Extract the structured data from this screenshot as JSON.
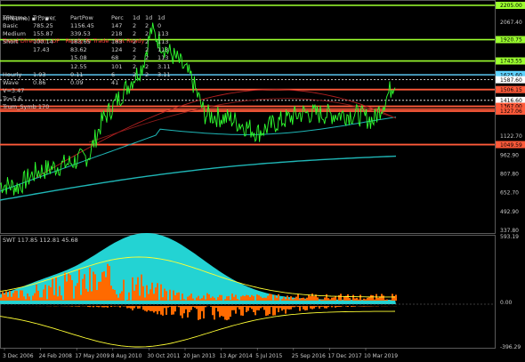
{
  "header": {
    "line1": "MM(1mo) ▪ ... ▪ ...",
    "trend_direction_label": "Trend Direction : UP",
    "ready_label": "Ready To Trade : Not Ready"
  },
  "table": {
    "headers": [
      "TFName",
      "TrPower",
      "PartPow",
      "Perc",
      "1d",
      "1d",
      "1d"
    ],
    "rows": [
      [
        "Basic",
        "785.25",
        "1156.45",
        "147",
        "2",
        "2",
        "0"
      ],
      [
        "Medium",
        "155.87",
        "339.53",
        "218",
        "2",
        "2",
        "113"
      ],
      [
        "Short",
        "100.14",
        "183.65",
        "183",
        "2",
        "2",
        "113"
      ],
      [
        "",
        "17.43",
        "83.62",
        "124",
        "2",
        "2",
        "113"
      ],
      [
        "",
        "",
        "15.08",
        "68",
        "2",
        "2",
        "113"
      ],
      [
        "",
        "",
        "12.55",
        "101",
        "2",
        "2",
        "3.11"
      ],
      [
        "Hourly",
        "1.93",
        "0.11",
        "6",
        "2",
        "2",
        "3.11"
      ],
      [
        "Wave",
        "0.86",
        "0.09",
        "41",
        "",
        "",
        ""
      ]
    ],
    "extra_lines": [
      "V=3.47",
      "Tr=5.6",
      "Trum_Symb 170"
    ]
  },
  "price_axis": {
    "ticks": [
      "2205.00",
      "2067.40",
      "1920.75",
      "1743.55",
      "1631.12",
      "1625.60",
      "1587.60",
      "1506.15",
      "1416.60",
      "1343.54",
      "1367.00",
      "1327.06",
      "1122.70",
      "1049.59",
      "962.90",
      "807.80",
      "652.70",
      "492.90",
      "337.80"
    ],
    "tags": [
      {
        "label": "2205.00",
        "color": "#9cff2f"
      },
      {
        "label": "1920.75",
        "color": "#9cff2f"
      },
      {
        "label": "1743.55",
        "color": "#9cff2f"
      },
      {
        "label": "1631.12",
        "color": "#5fd3ff"
      },
      {
        "label": "1625.60",
        "color": "#5fd3ff"
      },
      {
        "label": "1587.60",
        "color": "#ffffff"
      },
      {
        "label": "1506.15",
        "color": "#ff5a3a"
      },
      {
        "label": "1416.60",
        "color": "#ffffff"
      },
      {
        "label": "1343.54",
        "color": "#ff5a3a"
      },
      {
        "label": "1367.00",
        "color": "#ff5a3a"
      },
      {
        "label": "1327.06",
        "color": "#ff5a3a"
      },
      {
        "label": "1049.59",
        "color": "#ff5a3a"
      }
    ]
  },
  "sub_window": {
    "label": "SWT 117.85 112.81 45.68",
    "ticks": [
      "593.19",
      "0.00",
      "-396.29"
    ]
  },
  "time_axis": {
    "labels": [
      "3 Dec 2006",
      "24 Feb 2008",
      "17 May 2009",
      "8 Aug 2010",
      "30 Oct 2011",
      "20 Jan 2013",
      "13 Apr 2014",
      "5 Jul 2015",
      "25 Sep 2016",
      "17 Dec 2017",
      "10 Mar 2019"
    ]
  },
  "colors": {
    "background": "#000000",
    "price": "#2fff2f",
    "level_green": "#9cff2f",
    "level_red": "#ff3a1a",
    "ma_cyan": "#1fb6b6",
    "osc_cyan": "#23d3d3",
    "osc_orange": "#ff6a00",
    "osc_yellow": "#ffff33",
    "axis_text": "#c8c8c8"
  }
}
